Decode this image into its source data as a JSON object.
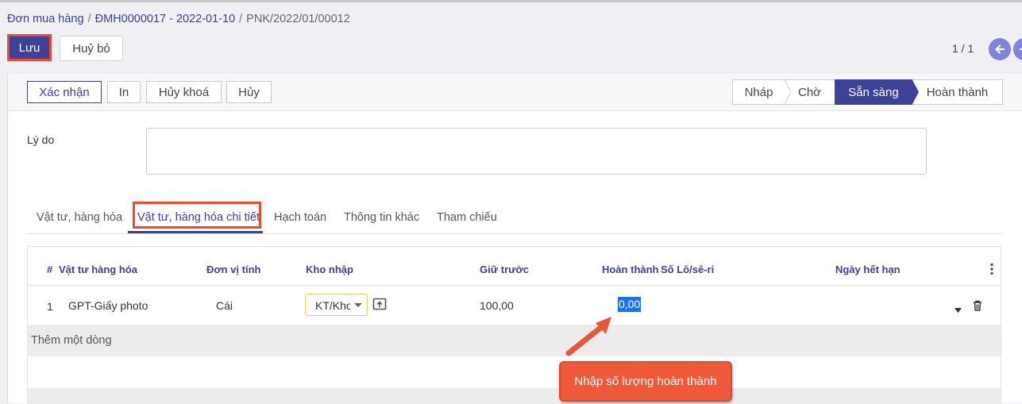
{
  "breadcrumb": {
    "item1": "Đơn mua hàng",
    "item2": "ĐMH0000017 - 2022-01-10",
    "item3": "PNK/2022/01/00012",
    "separator": "/"
  },
  "control_panel": {
    "save_label": "Lưu",
    "discard_label": "Huỷ bỏ",
    "pager": "1 / 1",
    "prev_icon": "arrow-left-icon",
    "next_icon": "arrow-right-icon"
  },
  "statusbar": {
    "buttons": [
      "Xác nhận",
      "In",
      "Hủy khoá",
      "Hủy"
    ],
    "steps": [
      "Nháp",
      "Chờ",
      "Sẵn sàng",
      "Hoàn thành"
    ],
    "active_step": "Sẵn sàng"
  },
  "form": {
    "reason_label": "Lý do",
    "reason_value": ""
  },
  "tabs": [
    "Vật tư, hàng hóa",
    "Vật tư, hàng hóa chi tiết",
    "Hạch toán",
    "Thông tin khác",
    "Tham chiếu"
  ],
  "active_tab": "Vật tư, hàng hóa chi tiết",
  "table": {
    "headers": [
      "#",
      "Vật tư hàng hóa",
      "Đơn vị tính",
      "Kho nhập",
      "Giữ trước",
      "Hoàn thành",
      "Số Lô/sê-ri",
      "Ngày hết hạn"
    ],
    "rows": [
      {
        "index": "1",
        "product": "GPT-Giấy photo",
        "uom": "Cái",
        "warehouse": "KT/Kho",
        "reserved": "100,00",
        "done": "0,00"
      }
    ],
    "add_line": "Thêm một dòng"
  },
  "annotation": {
    "callout_text": "Nhập số lượng hoàn thành"
  },
  "colors": {
    "primary": "#3d4198",
    "highlight_border": "#ea4a2e",
    "callout": "#f0583a",
    "selection": "#1a73e8"
  }
}
